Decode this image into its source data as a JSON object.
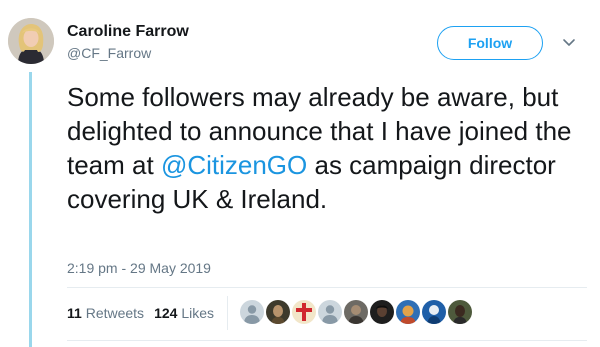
{
  "author": {
    "display_name": "Caroline Farrow",
    "handle": "@CF_Farrow",
    "avatar_icon": "profile-photo-woman-blonde"
  },
  "follow_button": {
    "label": "Follow"
  },
  "more_menu": {
    "icon": "chevron-down-icon"
  },
  "tweet": {
    "text_before": "Some followers may already be aware, but delighted to announce that I have joined the team at ",
    "mention": "@CitizenGO",
    "text_after": " as campaign director covering UK & Ireland.",
    "timestamp": "2:19 pm - 29 May 2019"
  },
  "stats": {
    "retweets_count": "11",
    "retweets_label": "Retweets",
    "likes_count": "124",
    "likes_label": "Likes"
  },
  "likers": [
    {
      "icon": "default-avatar-icon"
    },
    {
      "icon": "user-avatar-icon"
    },
    {
      "icon": "cross-avatar-icon"
    },
    {
      "icon": "default-avatar-icon"
    },
    {
      "icon": "user-avatar-icon"
    },
    {
      "icon": "user-avatar-icon"
    },
    {
      "icon": "user-avatar-icon"
    },
    {
      "icon": "user-avatar-icon"
    },
    {
      "icon": "user-avatar-icon"
    }
  ],
  "colors": {
    "brand_blue": "#1da1f2",
    "mention_blue": "#1b95e0",
    "thread_line": "#9ad7ec",
    "secondary_text": "#657786"
  }
}
